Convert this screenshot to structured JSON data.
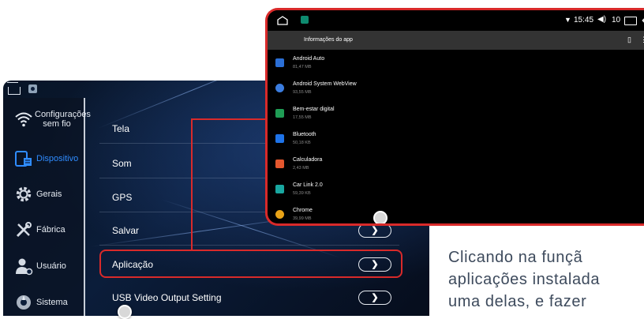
{
  "back_device": {
    "sidebar": {
      "items": [
        {
          "label": "Configurações sem fio",
          "icon": "wifi-icon"
        },
        {
          "label": "Dispositivo",
          "icon": "device-icon"
        },
        {
          "label": "Gerais",
          "icon": "gear-icon"
        },
        {
          "label": "Fábrica",
          "icon": "tools-icon"
        },
        {
          "label": "Usuário",
          "icon": "user-icon"
        },
        {
          "label": "Sistema",
          "icon": "system-icon"
        }
      ],
      "active_index": 1
    },
    "menu": {
      "items": [
        {
          "label": "Tela"
        },
        {
          "label": "Som"
        },
        {
          "label": "GPS"
        },
        {
          "label": "Salvar"
        },
        {
          "label": "Aplicação"
        },
        {
          "label": "USB Video Output Setting"
        }
      ],
      "chevron": "❯",
      "highlighted_index": 4
    }
  },
  "front_device": {
    "status_bar": {
      "time": "15:45",
      "volume": "10"
    },
    "header_title": "Informações do app",
    "apps": [
      {
        "name": "Android Auto",
        "size": "81,47 MB",
        "icon_color": "#2b6fd6"
      },
      {
        "name": "Android System WebView",
        "size": "93,55 MB",
        "icon_color": "#3b7de0"
      },
      {
        "name": "Bem-estar digital",
        "size": "17,55 MB",
        "icon_color": "#1f9d55"
      },
      {
        "name": "Bluetooth",
        "size": "50,18 KB",
        "icon_color": "#1e73e8"
      },
      {
        "name": "Calculadora",
        "size": "2,43 MB",
        "icon_color": "#e4572e"
      },
      {
        "name": "Car Link 2.0",
        "size": "59,39 KB",
        "icon_color": "#19a7a0"
      },
      {
        "name": "Chrome",
        "size": "39,99 MB",
        "icon_color": "#e8a317"
      }
    ]
  },
  "caption_lines": [
    "Clicando na funçã",
    "aplicações instalada",
    "uma delas, e fazer"
  ],
  "colors": {
    "highlight": "#d92a2a",
    "accent": "#2f8cff"
  }
}
